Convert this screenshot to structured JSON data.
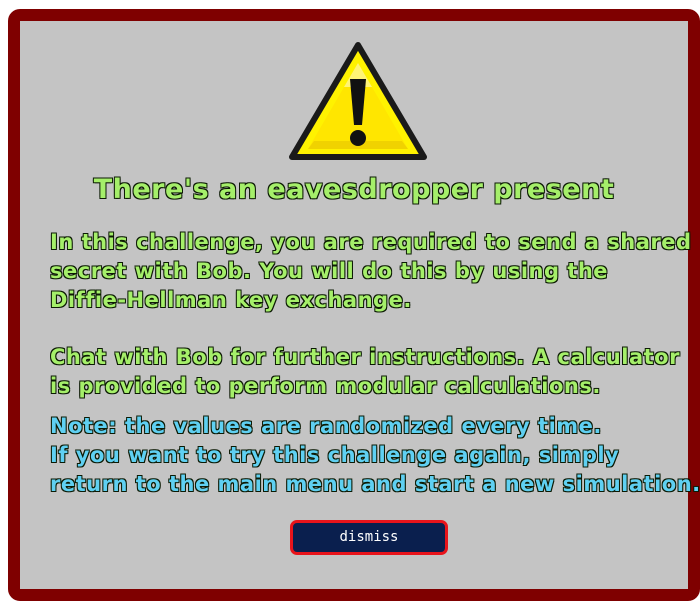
{
  "dialog": {
    "icon": "warning-triangle-icon",
    "title": "There's an eavesdropper present",
    "intro_lines": [
      "In this challenge, you are required to send a shared",
      "secret with Bob. You will do this by using the",
      "Diffie-Hellman key exchange."
    ],
    "instructions_lines": [
      "Chat with Bob for further instructions. A calculator",
      "is provided to perform modular calculations."
    ],
    "note_lines": [
      "Note: the values are randomized every time.",
      "If you want to try this challenge again, simply",
      "return to the main menu and start a new simulation."
    ],
    "dismiss_label": "dismiss"
  },
  "colors": {
    "border": "#7f0000",
    "panel": "#c4c4c4",
    "text_green": "#a5ef6a",
    "text_blue": "#5fd0f2",
    "button_bg": "#0a1f4e",
    "button_border": "#e8141b"
  }
}
